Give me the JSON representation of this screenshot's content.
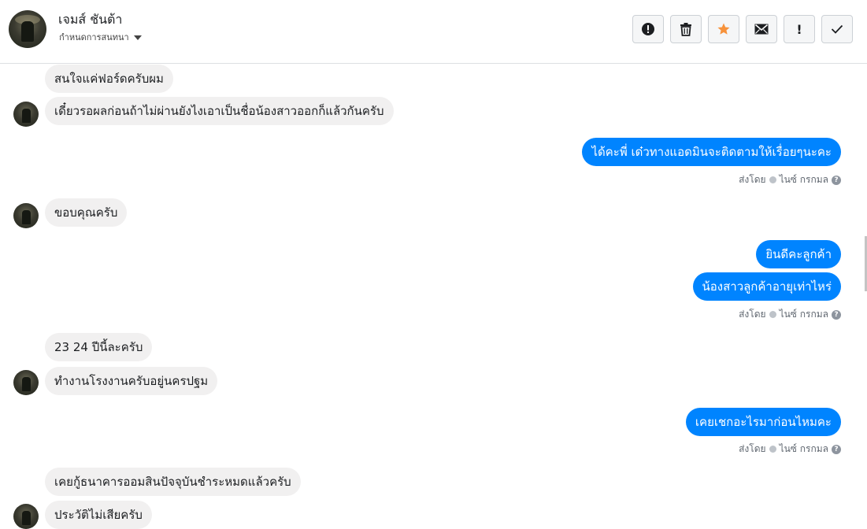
{
  "header": {
    "name": "เจมส์ ชันต้า",
    "subtitle": "กำหนดการสนทนา",
    "toolbar": [
      {
        "icon": "alert-circle-icon",
        "label": ""
      },
      {
        "icon": "trash-icon",
        "label": ""
      },
      {
        "icon": "star-icon",
        "label": ""
      },
      {
        "icon": "envelope-icon",
        "label": ""
      },
      {
        "icon": "exclamation-icon",
        "label": "!"
      },
      {
        "icon": "checkmark-icon",
        "label": ""
      }
    ]
  },
  "messages": {
    "m1": "สนใจแค่ฟอร์ดครับผม",
    "m2": "เดี๋ยวรอผลก่อนถ้าไม่ผ่านยังไงเอาเป็นชื่อน้องสาวออกก็แล้วกันครับ",
    "m3": "ได้คะพี่ เด๋วทางแอดมินจะติดตามให้เรื่อยๆนะคะ",
    "m4": "ขอบคุณครับ",
    "m5": "ยินดีคะลูกค้า",
    "m6": "น้องสาวลูกค้าอายุเท่าไหร่",
    "m7": "23 24 ปีนี้ละครับ",
    "m8": "ทำงานโรงงานครับอยู่นครปฐม",
    "m9": "เคยเชกอะไรมาก่อนไหมคะ",
    "m10": "เคยกู้ธนาคารออมสินปัจจุบันชำระหมดแล้วครับ",
    "m11": "ประวัติไม่เสียครับ"
  },
  "sent_by": {
    "prefix": "ส่งโดย",
    "agent": "ไนซ์ กรกมล",
    "help": "?"
  },
  "colors": {
    "outgoing": "#0084ff",
    "incoming": "#f1f0f0",
    "star": "#f7923b"
  }
}
